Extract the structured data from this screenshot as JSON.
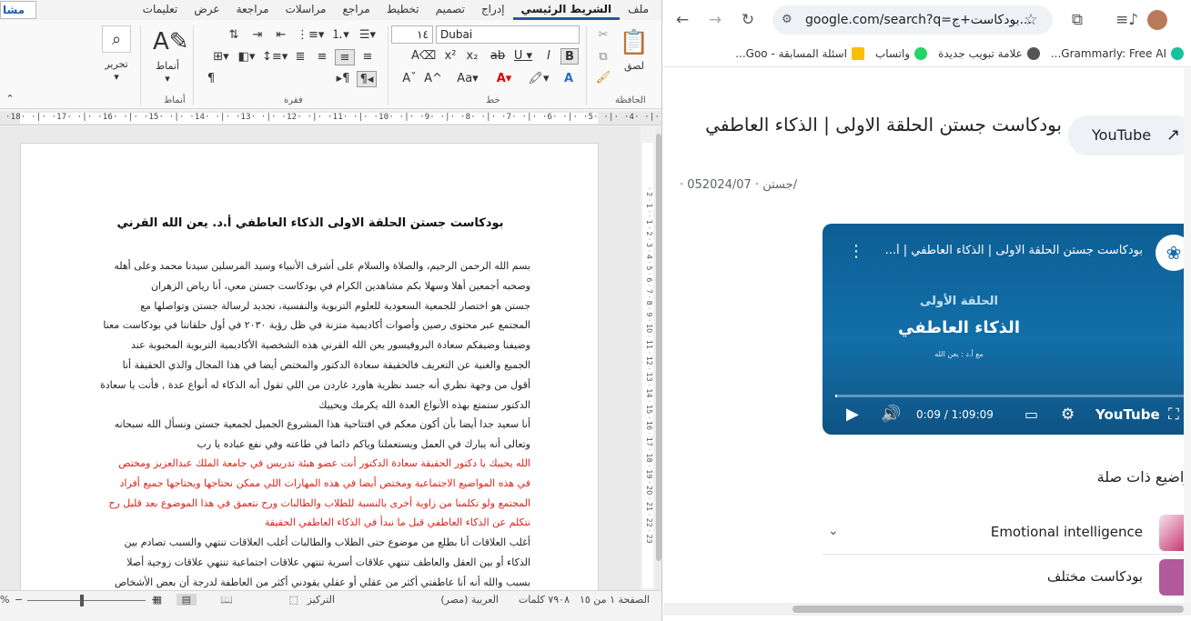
{
  "word": {
    "tabs": [
      "ملف",
      "الشريط الرئيسي",
      "إدراج",
      "تصميم",
      "تخطيط",
      "مراجع",
      "مراسلات",
      "مراجعة",
      "عرض",
      "تعليمات"
    ],
    "active_tab": "الشريط الرئيسي",
    "share_label": "مشا",
    "groups": {
      "clipboard": "الحافظة",
      "font": "خط",
      "paragraph": "فقرة",
      "styles": "أنماط"
    },
    "paste_label": "لصق",
    "styles_label": "أنماط",
    "editing_label": "تحرير",
    "font_name": "Dubai",
    "font_size": "١٤",
    "ruler_text": "·18· ·|· ·17· ·|· ·16· ·|· ·15· ·|· ·14· ·|· ·13· ·|· ·12· ·|· ·11· ·|· ·10· ·|· ·9· ·|· ·8· ·|· ·7· ·|· ·6· ·|· ·5· ·|· ·4· ·|· ·3· ·|· ·2· ·|· ·1·",
    "vruler_text": "· 2 · 1 · · 1 · 2 · 3 · 4 · 5 · 6 · 7 · 8 · 9 · 10 · 11 · 12 · 13 · 14 · 15 · 16 · 17 · 18 · 19 · 20 · 21 · 22 · 23",
    "doc_title": "بودكاست جستن الحلقة الاولى الذكاء العاطفي أ.د. يعن الله القرني",
    "para1": [
      "بسم الله الرحمن الرحيم، والصلاة والسلام على أشرف الأنبياء وسيد المرسلين سيدنا محمد وعلى أهله",
      "وصحبه أجمعين أهلا وسهلا بكم مشاهدين الكرام في بودكاست جستن معي، أنا رياض الزهران",
      "جستن هو اختصار للجمعية السعودية للعلوم التربوية والنفسية، تجديد لرسالة جستن وتواصلها مع",
      "المجتمع عبر محتوى رصين وأصوات أكاديمية متزنة في ظل رؤية ٢٠٣٠ في أول حلقاتنا في بودكاست معنا",
      "وضيفنا وضيفكم سعادة البروفيسور يعن الله القرني هذه الشخصية الأكاديمية التربوية المحبوبة عند",
      "الجميع والغنية عن التعريف فالحقيقة سعادة الدكتور والمختص أيضا في هذا المجال والذي الحقيقة أنا",
      "أقول من وجهة نظري أنه جسد نظرية هاورد غاردن من اللي تقول أنه الذكاء له أنواع عدة , فأنت يا سعادة",
      "الدكتور ستمتع بهذه الأنواع العدة الله يكرمك ويحييك"
    ],
    "para2": [
      "أنا سعيد جدا أيضا بأن أكون معكم في افتتاحية هذا المشروع الجميل لجمعية جستن ونسأل الله سبحانه",
      "وتعالى أنه يبارك في العمل ويستعملنا وياكم دائما في طاعته وفي نفع عباده يا رب"
    ],
    "para3_red": [
      "الله يحييك يا دكتور الحقيقة سعادة الدكتور أنت عضو هيئة تدريس في جامعة الملك عبدالعزيز ومختص",
      "في هذه المواضيع الاجتماعية ومختص أيضا في هذه المهارات اللي ممكن نحتاجها ويحتاجها جميع أفراد",
      "المجتمع ولو تكلمنا من زاوية أخرى بالنسبة للطلاب والطالبات ورح نتعمق في هذا الموضوع بعد قليل رح",
      "نتكلم عن الذكاء العاطفي قبل ما نبدأ في الذكاء العاطفي الحقيقة"
    ],
    "para4": [
      "أغلب العلاقات أنا بطلع من موضوع حتى الطلاب والطالبات أغلب العلاقات تنتهي والسبب تصادم بين",
      "الذكاء أو بين العقل والعاطف تنتهي علاقات أسرية تنتهي علاقات اجتماعية تنتهي علاقات زوجية أصلا",
      "بسبب والله أنه أنا عاطفتي أكثر من عقلي أو عقلي يقودني أكثر من العاطفة لدرجة أن بعض الأشخاص"
    ],
    "status": {
      "page": "الصفحة ١ من ١٥",
      "words": "٧٩٠٨ كلمات",
      "language": "العربية (مصر)",
      "focus": "التركيز",
      "zoom": "%"
    }
  },
  "chrome": {
    "url": "google.com/search?q=بودكاست+ج...",
    "bookmarks": [
      {
        "label": "Grammarly: Free AI...",
        "color": "#15c39a"
      },
      {
        "label": "علامة تبويب جديدة",
        "color": "#555555"
      },
      {
        "label": "واتساب",
        "color": "#25d366"
      },
      {
        "label": "اسئلة المسابقة - Goo...",
        "color": "#fbbc04"
      }
    ],
    "heading": "بودكاست جستن الحلقة الاولى | الذكاء العاطفي",
    "youtube_button": "YouTube",
    "meta": "· جستن · 052024/07/",
    "video": {
      "title": "بودكاست جستن الحلقة الاولى | الذكاء العاطفي | أ...",
      "episode": "الحلقة الأولى",
      "big_title": "الذكاء العاطفي",
      "guest": "مع أ.د : يعن الله",
      "time": "0:09 / 1:09:09",
      "brand": "YouTube",
      "progress": 0.002
    },
    "related_heading": "واضيع ذات صلة",
    "related": [
      {
        "label": "Emotional intelligence",
        "color": "#c2185b"
      },
      {
        "label": "بودكاست مختلف",
        "color": "#b05a9a"
      }
    ]
  }
}
